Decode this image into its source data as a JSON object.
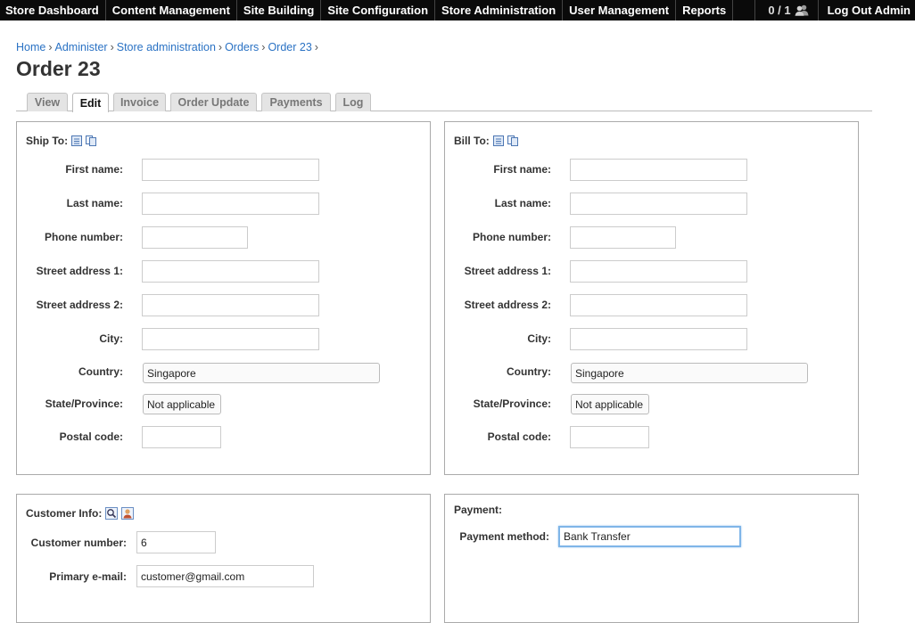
{
  "topbar": {
    "menu": [
      "Store Dashboard",
      "Content Management",
      "Site Building",
      "Site Configuration",
      "Store Administration",
      "User Management",
      "Reports"
    ],
    "user_count": "0 / 1",
    "logout": "Log Out Admin"
  },
  "breadcrumb": [
    "Home",
    "Administer",
    "Store administration",
    "Orders",
    "Order 23"
  ],
  "breadcrumb_sep": "›",
  "title": "Order 23",
  "tabs": [
    "View",
    "Edit",
    "Invoice",
    "Order Update",
    "Payments",
    "Log"
  ],
  "active_tab": "Edit",
  "ship_to": {
    "heading": "Ship To:",
    "labels": {
      "first_name": "First name:",
      "last_name": "Last name:",
      "phone": "Phone number:",
      "street1": "Street address 1:",
      "street2": "Street address 2:",
      "city": "City:",
      "country": "Country:",
      "state": "State/Province:",
      "postal": "Postal code:"
    },
    "values": {
      "first_name": "",
      "last_name": "",
      "phone": "",
      "street1": "",
      "street2": "",
      "city": "",
      "country": "Singapore",
      "state": "Not applicable",
      "postal": ""
    }
  },
  "bill_to": {
    "heading": "Bill To:",
    "labels": {
      "first_name": "First name:",
      "last_name": "Last name:",
      "phone": "Phone number:",
      "street1": "Street address 1:",
      "street2": "Street address 2:",
      "city": "City:",
      "country": "Country:",
      "state": "State/Province:",
      "postal": "Postal code:"
    },
    "values": {
      "first_name": "",
      "last_name": "",
      "phone": "",
      "street1": "",
      "street2": "",
      "city": "",
      "country": "Singapore",
      "state": "Not applicable",
      "postal": ""
    }
  },
  "customer_info": {
    "heading": "Customer Info:",
    "customer_number_label": "Customer number:",
    "customer_number": "6",
    "email_label": "Primary e-mail:",
    "email": "customer@gmail.com"
  },
  "payment": {
    "heading": "Payment:",
    "method_label": "Payment method:",
    "method": "Bank Transfer"
  },
  "colors": {
    "topbar_bg": "#0a0a0a",
    "link": "#2a72c4",
    "focus_ring": "#7fb5e8"
  }
}
